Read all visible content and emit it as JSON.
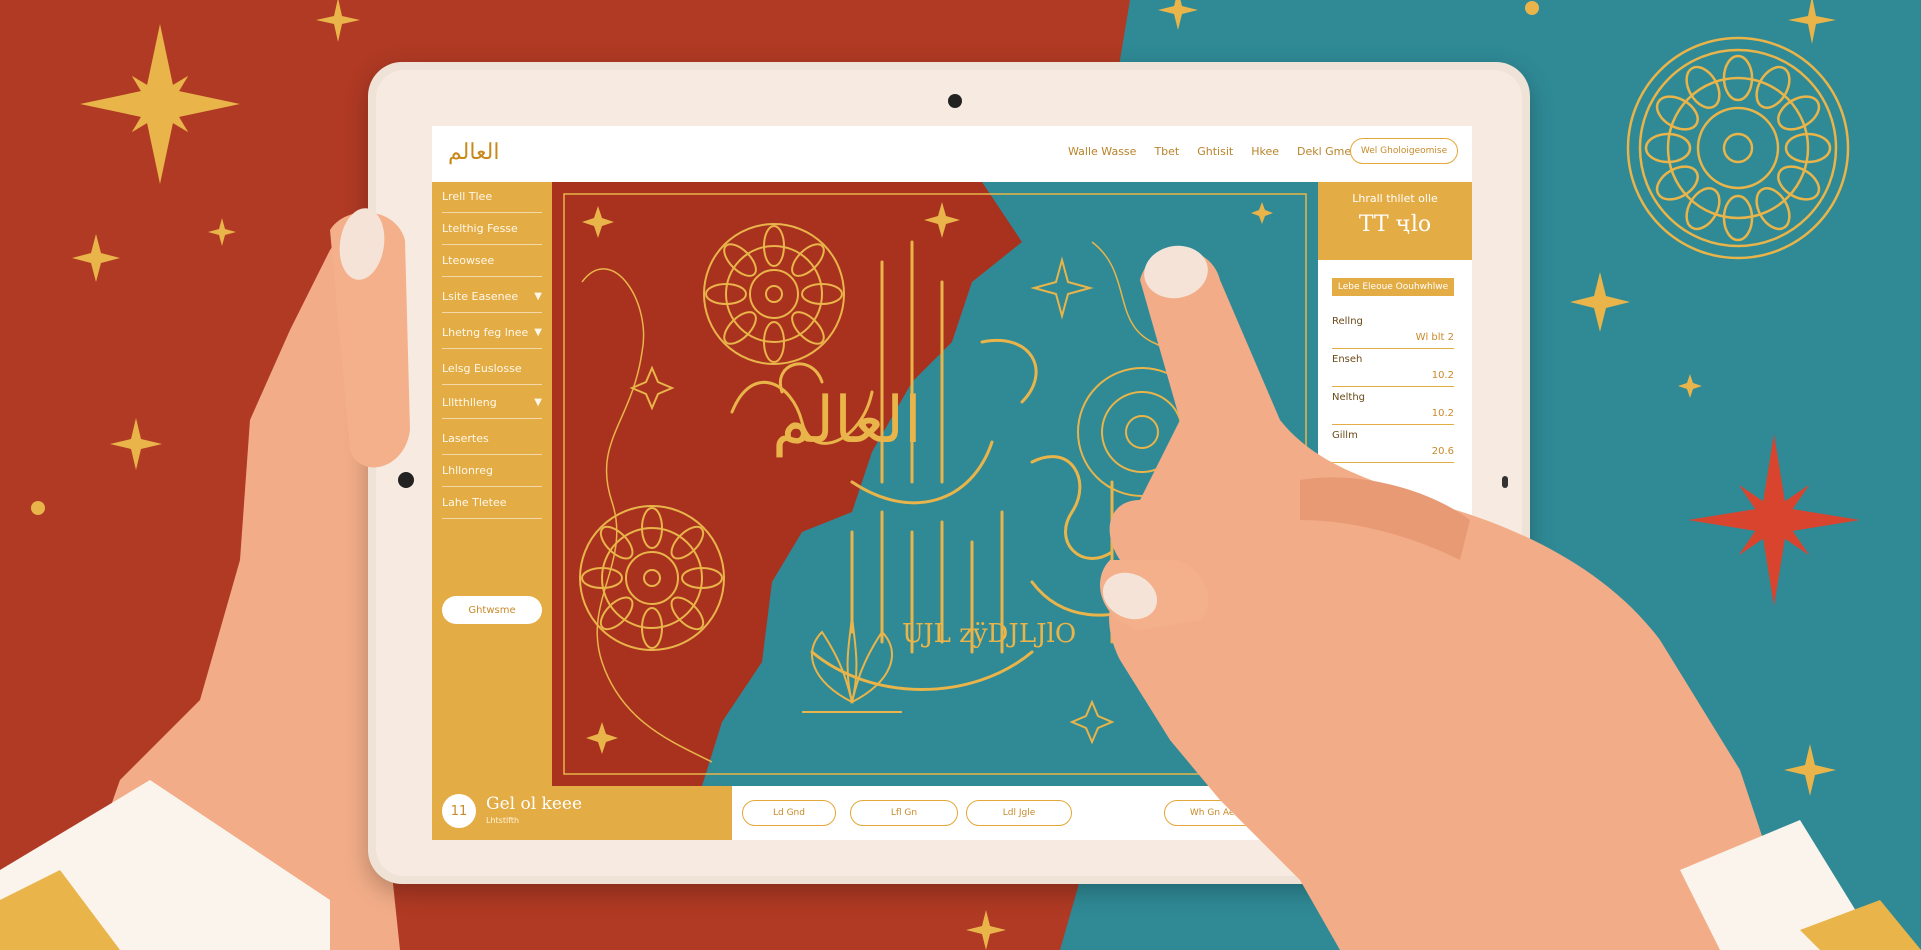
{
  "colors": {
    "red": "#b03a24",
    "teal": "#2f8a96",
    "gold": "#e4ac44",
    "skin": "#f2ad88",
    "tablet": "#f3e6db"
  },
  "header": {
    "logo": "العالم",
    "nav": [
      "Walle Wasse",
      "Tbet",
      "Ghtisit",
      "Hkee",
      "Dekl Gme"
    ],
    "cta": "Wel Gholoigeomise"
  },
  "sidebar": {
    "items": [
      {
        "label": "Lrell Tlee",
        "chevron": false
      },
      {
        "label": "Ltelthig Fesse",
        "chevron": false
      },
      {
        "label": "Lteowsee",
        "chevron": false
      },
      {
        "label": "Lsite Easenee",
        "chevron": true
      },
      {
        "label": "Lhetng feg lnee",
        "chevron": true
      },
      {
        "label": "Lelsg Euslosse",
        "chevron": false
      },
      {
        "label": "Llltthlleng",
        "chevron": true
      },
      {
        "label": "Lasertes",
        "chevron": false
      },
      {
        "label": "Lhllonreg",
        "chevron": false
      },
      {
        "label": "Lahe Tletee",
        "chevron": false
      }
    ],
    "button": "Ghtwsme"
  },
  "right_panel": {
    "head_small": "Lhrall thllet olle",
    "head_big": "TT ҷlo",
    "button": "Lebe Eleoue Oouhwhlwe",
    "rows": [
      {
        "label": "Rellng",
        "value": "Wl blt 2"
      },
      {
        "label": "Enseh",
        "value": "10.2"
      },
      {
        "label": "Nelthg",
        "value": "10.2"
      },
      {
        "label": "Gillm",
        "value": "20.6"
      }
    ]
  },
  "footer": {
    "avatar": "11",
    "name": "Gel ol keee",
    "subtitle": "Lhtstlfth",
    "pills": [
      "Ld Gnd",
      "Lfl Gn",
      "Ldl Jgle",
      "Wh Gn Aen"
    ]
  },
  "art": {
    "calligraphy": "العالم",
    "caption": "UJL zÿDJLJlO"
  }
}
